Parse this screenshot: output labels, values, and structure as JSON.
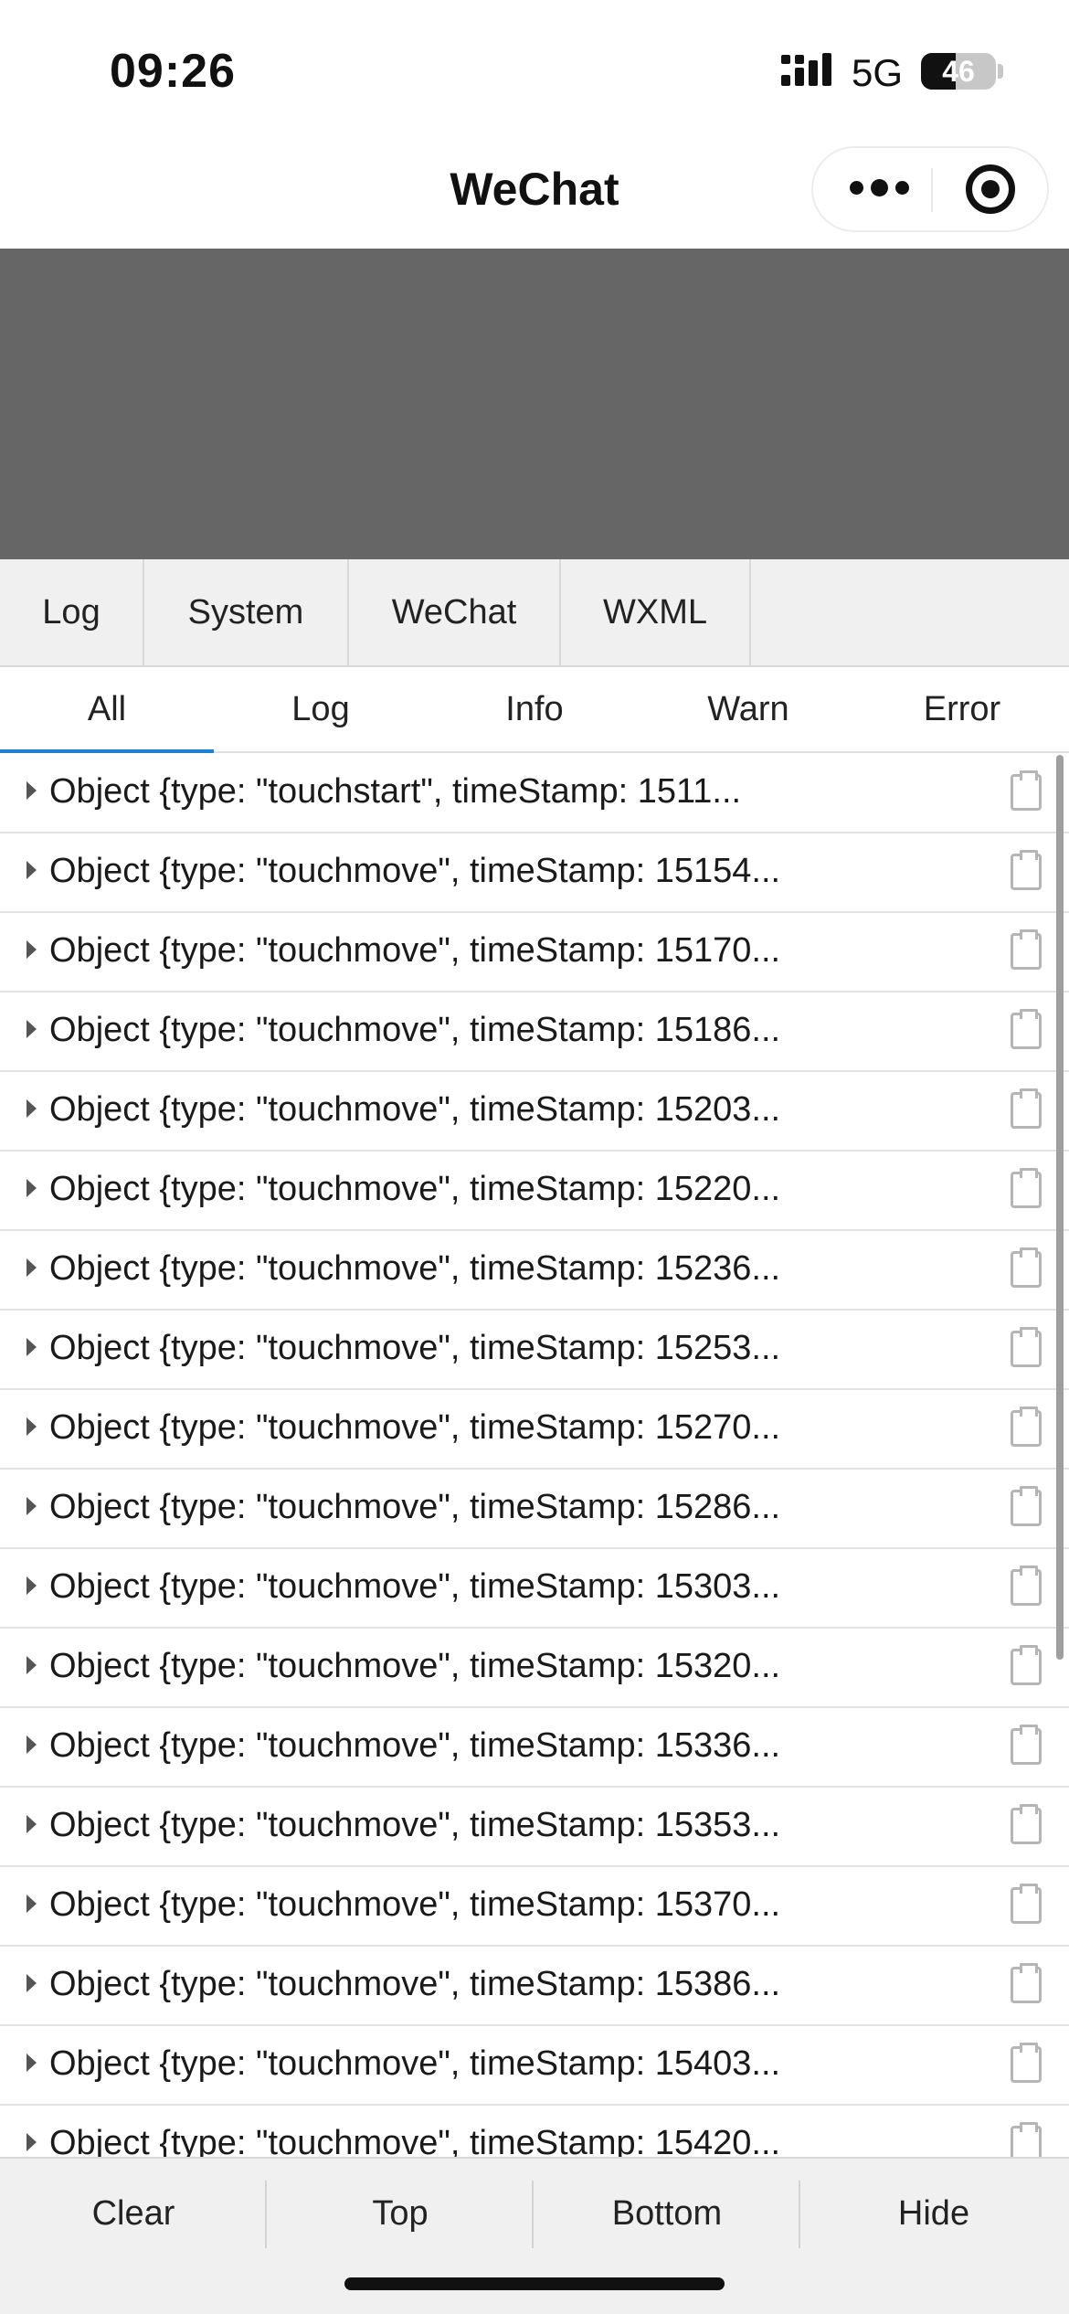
{
  "status_bar": {
    "time": "09:26",
    "network": "5G",
    "battery_level": "46",
    "battery_fraction": 0.46,
    "signal_icon": "signal-bars-icon"
  },
  "nav": {
    "title": "WeChat",
    "more_icon": "more-dots-icon",
    "close_icon": "target-close-icon"
  },
  "top_tabs": [
    {
      "label": "Log"
    },
    {
      "label": "System"
    },
    {
      "label": "WeChat"
    },
    {
      "label": "WXML"
    }
  ],
  "filter_tabs": [
    {
      "label": "All",
      "active": true
    },
    {
      "label": "Log"
    },
    {
      "label": "Info"
    },
    {
      "label": "Warn"
    },
    {
      "label": "Error"
    }
  ],
  "logs": [
    "Object {type: \"touchstart\", timeStamp: 1511...",
    "Object {type: \"touchmove\", timeStamp: 15154...",
    "Object {type: \"touchmove\", timeStamp: 15170...",
    "Object {type: \"touchmove\", timeStamp: 15186...",
    "Object {type: \"touchmove\", timeStamp: 15203...",
    "Object {type: \"touchmove\", timeStamp: 15220...",
    "Object {type: \"touchmove\", timeStamp: 15236...",
    "Object {type: \"touchmove\", timeStamp: 15253...",
    "Object {type: \"touchmove\", timeStamp: 15270...",
    "Object {type: \"touchmove\", timeStamp: 15286...",
    "Object {type: \"touchmove\", timeStamp: 15303...",
    "Object {type: \"touchmove\", timeStamp: 15320...",
    "Object {type: \"touchmove\", timeStamp: 15336...",
    "Object {type: \"touchmove\", timeStamp: 15353...",
    "Object {type: \"touchmove\", timeStamp: 15370...",
    "Object {type: \"touchmove\", timeStamp: 15386...",
    "Object {type: \"touchmove\", timeStamp: 15403...",
    "Object {type: \"touchmove\", timeStamp: 15420..."
  ],
  "toolbar": {
    "clear": "Clear",
    "top": "Top",
    "bottom": "Bottom",
    "hide": "Hide"
  },
  "colors": {
    "accent": "#1f7fd6",
    "placeholder_block": "#666666",
    "tab_bar_bg": "#f0f0f0"
  }
}
